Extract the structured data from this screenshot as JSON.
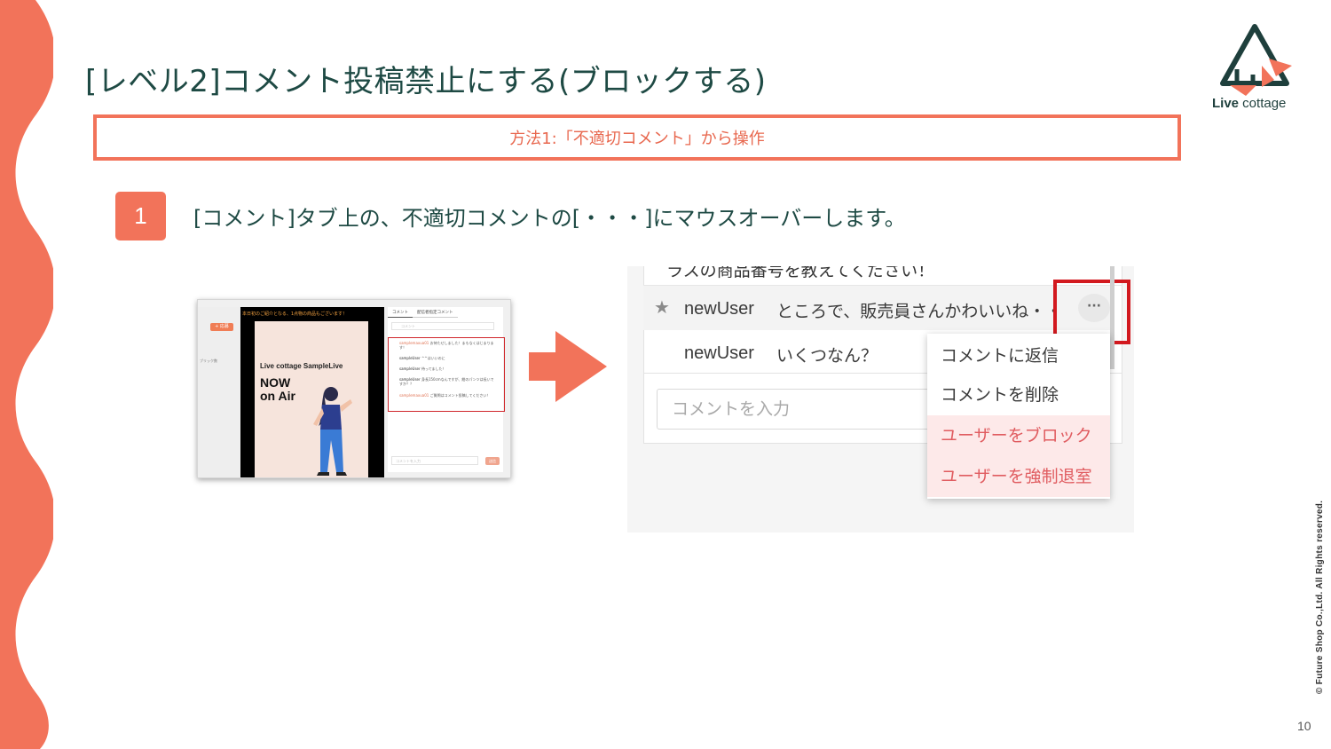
{
  "title": "[レベル2]コメント投稿禁止にする(ブロックする)",
  "logo": {
    "brand_bold": "Live",
    "brand_rest": " cottage"
  },
  "method": {
    "label": "方法1:「不適切コメント」から操作"
  },
  "step": {
    "number": "1",
    "text": "[コメント]タブ上の、不適切コメントの[・・・]にマウスオーバーします。"
  },
  "small_screenshot": {
    "left_button": "+ 応募",
    "left_label": "ブリック数",
    "banner": "本日初のご紹介となる、1点物の商品もございます！",
    "live_name": "Live cottage SampleLive",
    "now_on_air": [
      "NOW",
      "on Air"
    ],
    "tabs": [
      "コメント",
      "配信者指定コメント"
    ],
    "search_placeholder": "コメント",
    "comments": [
      {
        "user": "samplemaxua01",
        "text": "お待たせしました！まもなくはじまります！",
        "owner": true
      },
      {
        "user": "sampleUser",
        "text": "^^はいいのに",
        "owner": false
      },
      {
        "user": "sampleUser",
        "text": "待ってました！",
        "owner": false
      },
      {
        "user": "sampleUser",
        "text": "身長150cmなんですが、紺のパンツは長いですか？？",
        "owner": false
      },
      {
        "user": "samplemaxua01",
        "text": "ご質問はコメント投稿してください！",
        "owner": true
      }
    ],
    "input_placeholder": "コメントを入力",
    "send_label": "送信"
  },
  "big_screenshot": {
    "cut_text": "ラスの商品番号を教えてください！",
    "rows": [
      {
        "user": "newUser",
        "text": "ところで、販売員さんかわいいね・・"
      },
      {
        "user": "newUser",
        "text": "いくつなん？"
      }
    ],
    "dots": "···",
    "input_placeholder": "コメントを入力",
    "menu": [
      {
        "label": "コメントに返信",
        "danger": false
      },
      {
        "label": "コメントを削除",
        "danger": false
      },
      {
        "label": "ユーザーをブロック",
        "danger": true
      },
      {
        "label": "ユーザーを強制退室",
        "danger": true
      }
    ]
  },
  "colors": {
    "accent": "#f2735a",
    "title": "#1e4a44",
    "highlight_red": "#d2191f"
  },
  "footer": {
    "page_number": "10",
    "copyright": "© Future Shop Co.,Ltd. All Rights reserved."
  }
}
